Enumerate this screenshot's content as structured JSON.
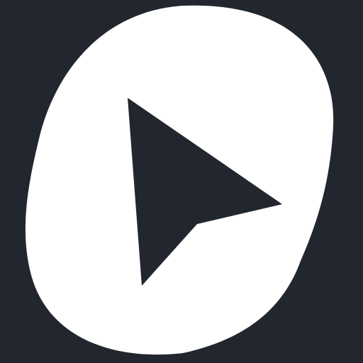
{
  "icon": {
    "name": "cursor-arrow-logo",
    "colors": {
      "background": "#22262e",
      "blob": "#ffffff",
      "arrow": "#22262e"
    }
  }
}
